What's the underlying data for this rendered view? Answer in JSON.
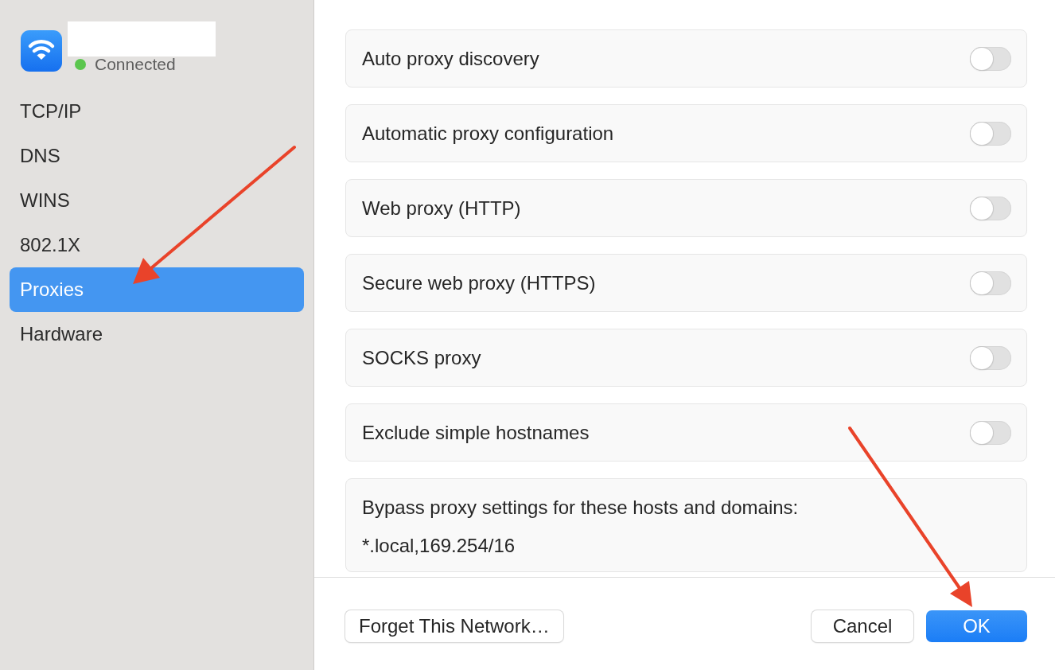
{
  "sidebar": {
    "network": {
      "status": "Connected"
    },
    "items": [
      {
        "label": "TCP/IP",
        "selected": false
      },
      {
        "label": "DNS",
        "selected": false
      },
      {
        "label": "WINS",
        "selected": false
      },
      {
        "label": "802.1X",
        "selected": false
      },
      {
        "label": "Proxies",
        "selected": true
      },
      {
        "label": "Hardware",
        "selected": false
      }
    ]
  },
  "proxy_options": [
    {
      "label": "Auto proxy discovery",
      "on": false
    },
    {
      "label": "Automatic proxy configuration",
      "on": false
    },
    {
      "label": "Web proxy (HTTP)",
      "on": false
    },
    {
      "label": "Secure web proxy (HTTPS)",
      "on": false
    },
    {
      "label": "SOCKS proxy",
      "on": false
    },
    {
      "label": "Exclude simple hostnames",
      "on": false
    }
  ],
  "bypass": {
    "label": "Bypass proxy settings for these hosts and domains:",
    "value": "*.local,169.254/16"
  },
  "buttons": [
    {
      "label": "Forget This Network…",
      "kind": "secondary"
    },
    {
      "label": "Cancel",
      "kind": "secondary"
    },
    {
      "label": "OK",
      "kind": "primary"
    }
  ]
}
